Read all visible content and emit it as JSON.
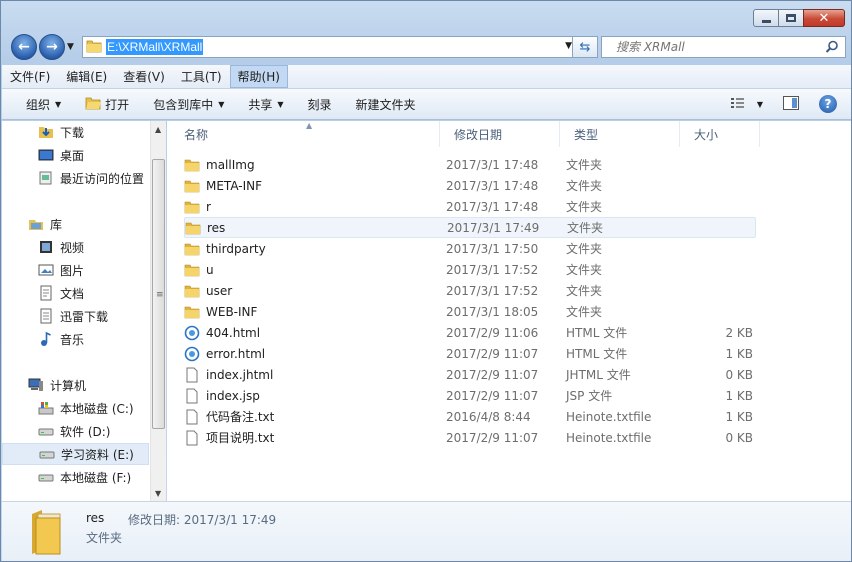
{
  "window": {
    "minimize_icon": "minimize-icon",
    "maximize_icon": "maximize-icon",
    "close_icon": "close-icon"
  },
  "nav": {
    "address_path": "E:\\XRMall\\XRMall",
    "search_placeholder": "搜索 XRMall"
  },
  "menu": [
    "文件(F)",
    "编辑(E)",
    "查看(V)",
    "工具(T)",
    "帮助(H)"
  ],
  "menu_active": "帮助(H)",
  "toolbar": {
    "organize": "组织",
    "open": "打开",
    "include_library": "包含到库中",
    "share": "共享",
    "burn": "刻录",
    "new_folder": "新建文件夹"
  },
  "sidebar": {
    "items": [
      {
        "label": "下载",
        "icon": "download-folder-icon"
      },
      {
        "label": "桌面",
        "icon": "desktop-icon"
      },
      {
        "label": "最近访问的位置",
        "icon": "recent-places-icon"
      },
      {
        "label": "库",
        "icon": "library-icon"
      },
      {
        "label": "视频",
        "icon": "video-icon"
      },
      {
        "label": "图片",
        "icon": "pictures-icon"
      },
      {
        "label": "文档",
        "icon": "documents-icon"
      },
      {
        "label": "迅雷下载",
        "icon": "thunder-download-icon"
      },
      {
        "label": "音乐",
        "icon": "music-icon"
      },
      {
        "label": "计算机",
        "icon": "computer-icon"
      },
      {
        "label": "本地磁盘 (C:)",
        "icon": "system-drive-icon"
      },
      {
        "label": "软件 (D:)",
        "icon": "drive-icon"
      },
      {
        "label": "学习资料 (E:)",
        "icon": "drive-icon"
      },
      {
        "label": "本地磁盘 (F:)",
        "icon": "drive-icon"
      }
    ],
    "selected": "学习资料 (E:)"
  },
  "columns": {
    "name": "名称",
    "date": "修改日期",
    "type": "类型",
    "size": "大小"
  },
  "files": [
    {
      "name": "mallImg",
      "date": "2017/3/1 17:48",
      "type": "文件夹",
      "size": "",
      "icon": "folder-icon"
    },
    {
      "name": "META-INF",
      "date": "2017/3/1 17:48",
      "type": "文件夹",
      "size": "",
      "icon": "folder-icon"
    },
    {
      "name": "r",
      "date": "2017/3/1 17:48",
      "type": "文件夹",
      "size": "",
      "icon": "folder-icon"
    },
    {
      "name": "res",
      "date": "2017/3/1 17:49",
      "type": "文件夹",
      "size": "",
      "icon": "folder-icon"
    },
    {
      "name": "thirdparty",
      "date": "2017/3/1 17:50",
      "type": "文件夹",
      "size": "",
      "icon": "folder-icon"
    },
    {
      "name": "u",
      "date": "2017/3/1 17:52",
      "type": "文件夹",
      "size": "",
      "icon": "folder-icon"
    },
    {
      "name": "user",
      "date": "2017/3/1 17:52",
      "type": "文件夹",
      "size": "",
      "icon": "folder-icon"
    },
    {
      "name": "WEB-INF",
      "date": "2017/3/1 18:05",
      "type": "文件夹",
      "size": "",
      "icon": "folder-icon"
    },
    {
      "name": "404.html",
      "date": "2017/2/9 11:06",
      "type": "HTML 文件",
      "size": "2 KB",
      "icon": "html-file-icon"
    },
    {
      "name": "error.html",
      "date": "2017/2/9 11:07",
      "type": "HTML 文件",
      "size": "1 KB",
      "icon": "html-file-icon"
    },
    {
      "name": "index.jhtml",
      "date": "2017/2/9 11:07",
      "type": "JHTML 文件",
      "size": "0 KB",
      "icon": "file-icon"
    },
    {
      "name": "index.jsp",
      "date": "2017/2/9 11:07",
      "type": "JSP 文件",
      "size": "1 KB",
      "icon": "file-icon"
    },
    {
      "name": "代码备注.txt",
      "date": "2016/4/8 8:44",
      "type": "Heinote.txtfile",
      "size": "1 KB",
      "icon": "text-file-icon"
    },
    {
      "name": "项目说明.txt",
      "date": "2017/2/9 11:07",
      "type": "Heinote.txtfile",
      "size": "0 KB",
      "icon": "text-file-icon"
    }
  ],
  "hovered_file": "res",
  "details": {
    "name": "res",
    "modified_label": "修改日期: 2017/3/1 17:49",
    "type": "文件夹"
  }
}
